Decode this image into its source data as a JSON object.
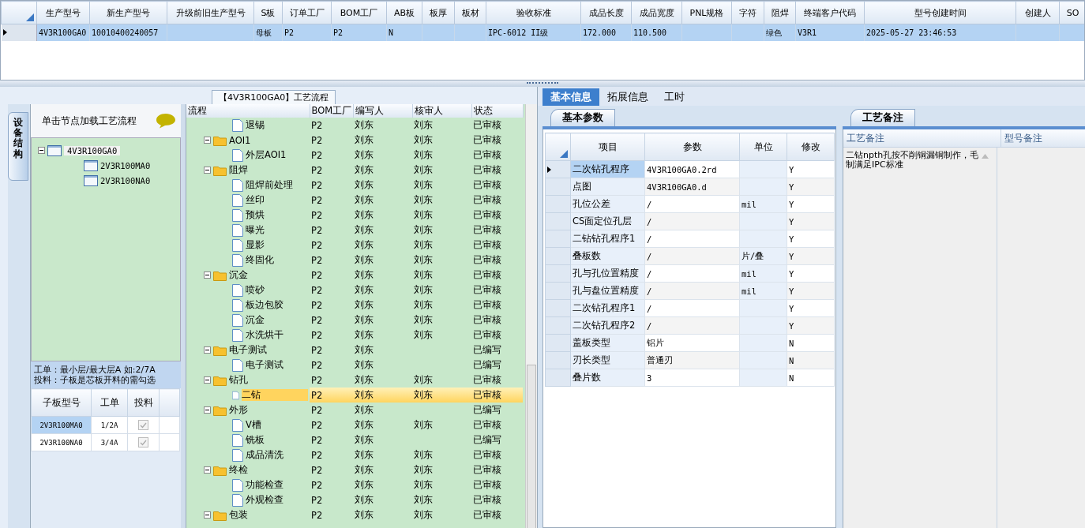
{
  "model_grid": {
    "columns": [
      "生产型号",
      "新生产型号",
      "升级前旧生产型号",
      "S板",
      "订单工厂",
      "BOM工厂",
      "AB板",
      "板厚",
      "板材",
      "验收标准",
      "成品长度",
      "成品宽度",
      "PNL规格",
      "字符",
      "阻焊",
      "终端客户代码",
      "型号创建时间",
      "创建人",
      "SO"
    ],
    "rows": [
      {
        "selected": true,
        "cells": [
          "4V3R100GA0",
          "10010400240057",
          null,
          "母板",
          "P2",
          "P2",
          "N",
          null,
          null,
          "IPC-6012 II级",
          "172.000",
          "110.500",
          null,
          null,
          "绿色",
          "V3R1",
          "2025-05-27 23:46:53",
          null,
          null
        ]
      }
    ]
  },
  "left_panel": {
    "title": "【4V3R100GA0】工艺流程"
  },
  "structure": {
    "tab": "设备结构",
    "hint": "单击节点加载工艺流程",
    "tree": [
      {
        "label": "4V3R100GA0",
        "expanded": true,
        "children": [
          {
            "label": "2V3R100MA0"
          },
          {
            "label": "2V3R100NA0"
          }
        ]
      }
    ],
    "notes": [
      "工单：最小层/最大层A 如:2/7A",
      "投料：子板是芯板开料的需勾选"
    ],
    "sub_table": {
      "columns": [
        "子板型号",
        "工单",
        "投料"
      ],
      "rows": [
        {
          "model": "2V3R100MA0",
          "order": "1/2A",
          "checked": true,
          "selected": true
        },
        {
          "model": "2V3R100NA0",
          "order": "3/4A",
          "checked": true,
          "selected": false
        }
      ]
    }
  },
  "process": {
    "columns": [
      "流程",
      "BOM工厂",
      "编写人",
      "核审人",
      "状态"
    ],
    "rows": [
      {
        "kind": "step",
        "name": "退锡",
        "bom": "P2",
        "author": "刘东",
        "reviewer": "刘东",
        "status": "已审核",
        "selected": false
      },
      {
        "kind": "group",
        "name": "AOI1",
        "bom": "P2",
        "author": "刘东",
        "reviewer": "刘东",
        "status": "已审核",
        "selected": false,
        "expanded": true,
        "children": [
          {
            "kind": "step",
            "name": "外层AOI1",
            "bom": "P2",
            "author": "刘东",
            "reviewer": "刘东",
            "status": "已审核",
            "selected": false
          }
        ]
      },
      {
        "kind": "group",
        "name": "阻焊",
        "bom": "P2",
        "author": "刘东",
        "reviewer": "刘东",
        "status": "已审核",
        "selected": false,
        "expanded": true,
        "children": [
          {
            "kind": "step",
            "name": "阻焊前处理",
            "bom": "P2",
            "author": "刘东",
            "reviewer": "刘东",
            "status": "已审核",
            "selected": false
          },
          {
            "kind": "step",
            "name": "丝印",
            "bom": "P2",
            "author": "刘东",
            "reviewer": "刘东",
            "status": "已审核",
            "selected": false
          },
          {
            "kind": "step",
            "name": "预烘",
            "bom": "P2",
            "author": "刘东",
            "reviewer": "刘东",
            "status": "已审核",
            "selected": false
          },
          {
            "kind": "step",
            "name": "曝光",
            "bom": "P2",
            "author": "刘东",
            "reviewer": "刘东",
            "status": "已审核",
            "selected": false
          },
          {
            "kind": "step",
            "name": "显影",
            "bom": "P2",
            "author": "刘东",
            "reviewer": "刘东",
            "status": "已审核",
            "selected": false
          },
          {
            "kind": "step",
            "name": "终固化",
            "bom": "P2",
            "author": "刘东",
            "reviewer": "刘东",
            "status": "已审核",
            "selected": false
          }
        ]
      },
      {
        "kind": "group",
        "name": "沉金",
        "bom": "P2",
        "author": "刘东",
        "reviewer": "刘东",
        "status": "已审核",
        "selected": false,
        "expanded": true,
        "children": [
          {
            "kind": "step",
            "name": "喷砂",
            "bom": "P2",
            "author": "刘东",
            "reviewer": "刘东",
            "status": "已审核",
            "selected": false
          },
          {
            "kind": "step",
            "name": "板边包胶",
            "bom": "P2",
            "author": "刘东",
            "reviewer": "刘东",
            "status": "已审核",
            "selected": false
          },
          {
            "kind": "step",
            "name": "沉金",
            "bom": "P2",
            "author": "刘东",
            "reviewer": "刘东",
            "status": "已审核",
            "selected": false
          },
          {
            "kind": "step",
            "name": "水洗烘干",
            "bom": "P2",
            "author": "刘东",
            "reviewer": "刘东",
            "status": "已审核",
            "selected": false
          }
        ]
      },
      {
        "kind": "group",
        "name": "电子测试",
        "bom": "P2",
        "author": "刘东",
        "status": "已编写",
        "selected": false,
        "expanded": true,
        "children": [
          {
            "kind": "step",
            "name": "电子测试",
            "bom": "P2",
            "author": "刘东",
            "status": "已编写",
            "selected": false
          }
        ]
      },
      {
        "kind": "group",
        "name": "钻孔",
        "bom": "P2",
        "author": "刘东",
        "reviewer": "刘东",
        "status": "已审核",
        "selected": false,
        "expanded": true,
        "children": [
          {
            "kind": "step",
            "name": "二钻",
            "bom": "P2",
            "author": "刘东",
            "reviewer": "刘东",
            "status": "已审核",
            "selected": true
          }
        ]
      },
      {
        "kind": "group",
        "name": "外形",
        "bom": "P2",
        "author": "刘东",
        "status": "已编写",
        "selected": false,
        "expanded": true,
        "children": [
          {
            "kind": "step",
            "name": "V槽",
            "bom": "P2",
            "author": "刘东",
            "reviewer": "刘东",
            "status": "已审核",
            "selected": false
          },
          {
            "kind": "step",
            "name": "铣板",
            "bom": "P2",
            "author": "刘东",
            "status": "已编写",
            "selected": false
          },
          {
            "kind": "step",
            "name": "成品清洗",
            "bom": "P2",
            "author": "刘东",
            "reviewer": "刘东",
            "status": "已审核",
            "selected": false
          }
        ]
      },
      {
        "kind": "group",
        "name": "终检",
        "bom": "P2",
        "author": "刘东",
        "reviewer": "刘东",
        "status": "已审核",
        "selected": false,
        "expanded": true,
        "children": [
          {
            "kind": "step",
            "name": "功能检查",
            "bom": "P2",
            "author": "刘东",
            "reviewer": "刘东",
            "status": "已审核",
            "selected": false
          },
          {
            "kind": "step",
            "name": "外观检查",
            "bom": "P2",
            "author": "刘东",
            "reviewer": "刘东",
            "status": "已审核",
            "selected": false
          }
        ]
      },
      {
        "kind": "group",
        "name": "包装",
        "bom": "P2",
        "author": "刘东",
        "reviewer": "刘东",
        "status": "已审核",
        "selected": false,
        "expanded": true
      }
    ]
  },
  "right_tabs": [
    {
      "label": "基本信息",
      "selected": true
    },
    {
      "label": "拓展信息",
      "selected": false
    },
    {
      "label": "工时",
      "selected": false
    }
  ],
  "params": {
    "tab": "基本参数",
    "columns": [
      "项目",
      "参数",
      "单位",
      "修改"
    ],
    "rows": [
      {
        "item": "二次钻孔程序",
        "value": "4V3R100GA0.2rd",
        "modify": "Y",
        "selected": true
      },
      {
        "item": "点图",
        "value": "4V3R100GA0.d",
        "modify": "Y",
        "selected": false
      },
      {
        "item": "孔位公差",
        "value": "/",
        "unit": "mil",
        "modify": "Y",
        "selected": false
      },
      {
        "item": "CS面定位孔层",
        "value": "/",
        "modify": "Y",
        "selected": false
      },
      {
        "item": "二钻钻孔程序1",
        "value": "/",
        "modify": "Y",
        "selected": false
      },
      {
        "item": "叠板数",
        "value": "/",
        "unit": "片/叠",
        "modify": "Y",
        "selected": false
      },
      {
        "item": "孔与孔位置精度",
        "value": "/",
        "unit": "mil",
        "modify": "Y",
        "selected": false
      },
      {
        "item": "孔与盘位置精度",
        "value": "/",
        "unit": "mil",
        "modify": "Y",
        "selected": false
      },
      {
        "item": "二次钻孔程序1",
        "value": "/",
        "modify": "Y",
        "selected": false
      },
      {
        "item": "二次钻孔程序2",
        "value": "/",
        "modify": "Y",
        "selected": false
      },
      {
        "item": "盖板类型",
        "value": "铝片",
        "modify": "N",
        "selected": false
      },
      {
        "item": "刃长类型",
        "value": "普通刃",
        "modify": "N",
        "selected": false
      },
      {
        "item": "叠片数",
        "value": "3",
        "modify": "N",
        "selected": false
      }
    ]
  },
  "remarks": {
    "tab": "工艺备注",
    "columns": [
      "工艺备注",
      "型号备注"
    ],
    "process_note": "二钻npth孔按不削铜漏铜制作，毛制满足IPC标准"
  }
}
